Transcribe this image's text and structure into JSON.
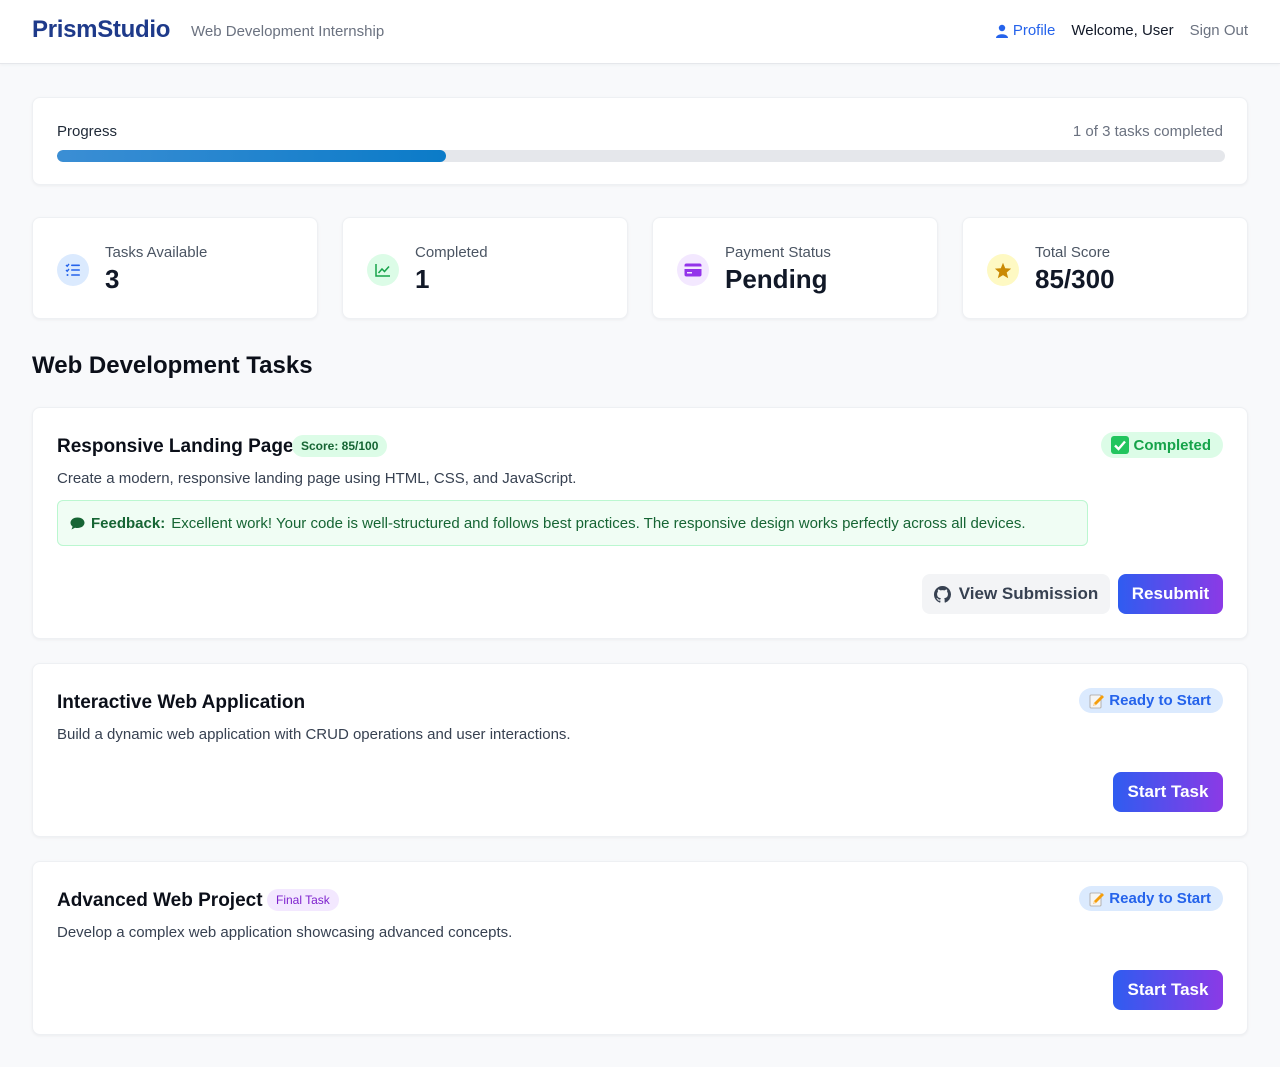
{
  "header": {
    "brand": "PrismStudio",
    "subtitle": "Web Development Internship",
    "profile_label": "Profile",
    "welcome": "Welcome, User",
    "signout": "Sign Out"
  },
  "progress": {
    "label": "Progress",
    "count_text": "1 of 3 tasks completed",
    "completed": 1,
    "total": 3
  },
  "stats": [
    {
      "label": "Tasks Available",
      "value": "3",
      "icon": "task-list-icon",
      "color": "#2563eb",
      "bg": "#dbeafe"
    },
    {
      "label": "Completed",
      "value": "1",
      "icon": "chart-line-icon",
      "color": "#16a34a",
      "bg": "#dcfce7"
    },
    {
      "label": "Payment Status",
      "value": "Pending",
      "icon": "credit-card-icon",
      "color": "#9333ea",
      "bg": "#f3e8ff"
    },
    {
      "label": "Total Score",
      "value": "85/300",
      "icon": "star-icon",
      "color": "#ca8a04",
      "bg": "#fef9c3"
    }
  ],
  "section_title": "Web Development Tasks",
  "tasks": [
    {
      "title": "Responsive Landing Page",
      "badge": "Score: 85/100",
      "status": "Completed",
      "status_icon": "check-icon",
      "description": "Create a modern, responsive landing page using HTML, CSS, and JavaScript.",
      "feedback_label": "Feedback:",
      "feedback_text": "Excellent work! Your code is well-structured and follows best practices. The responsive design works perfectly across all devices.",
      "secondary_button": "View Submission",
      "primary_button": "Resubmit"
    },
    {
      "title": "Interactive Web Application",
      "status": "Ready to Start",
      "status_icon": "pencil-icon",
      "description": "Build a dynamic web application with CRUD operations and user interactions.",
      "primary_button": "Start Task"
    },
    {
      "title": "Advanced Web Project",
      "badge": "Final Task",
      "status": "Ready to Start",
      "status_icon": "pencil-icon",
      "description": "Develop a complex web application showcasing advanced concepts.",
      "primary_button": "Start Task"
    }
  ]
}
